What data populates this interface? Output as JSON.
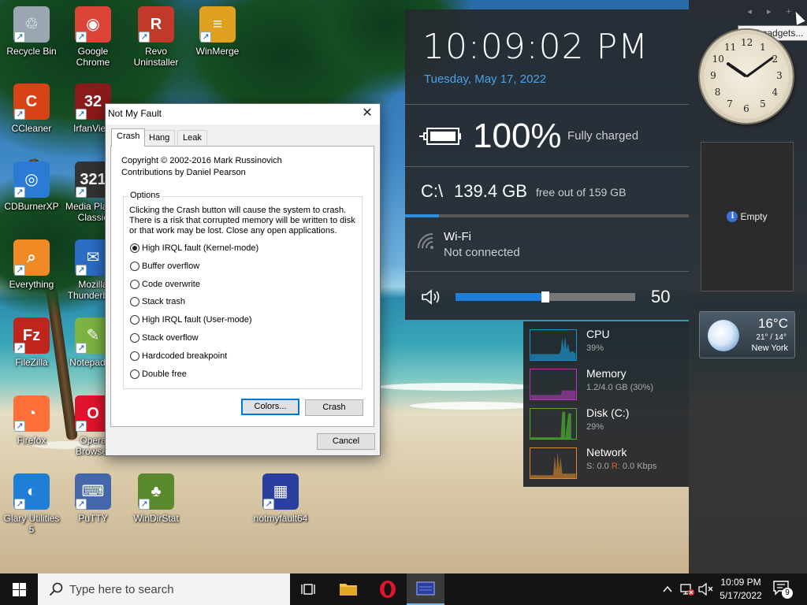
{
  "desktop": {
    "icons": [
      {
        "label": "Recycle Bin",
        "glyph": "♲",
        "color": "#9aa7b3"
      },
      {
        "label": "Google Chrome",
        "glyph": "◉",
        "color": "#db4437"
      },
      {
        "label": "Revo Uninstaller",
        "glyph": "R",
        "color": "#c0392b"
      },
      {
        "label": "WinMerge",
        "glyph": "≡",
        "color": "#e0a020"
      },
      {
        "label": "CCleaner",
        "glyph": "C",
        "color": "#d84315"
      },
      {
        "label": "IrfanView",
        "glyph": "32",
        "color": "#8b1a1a"
      },
      {
        "label": "CDBurnerXP",
        "glyph": "◎",
        "color": "#2a7bd6"
      },
      {
        "label": "Media Player Classic",
        "glyph": "321",
        "color": "#333333"
      },
      {
        "label": "Everything",
        "glyph": "⌕",
        "color": "#f08a24"
      },
      {
        "label": "Mozilla Thunderbird",
        "glyph": "✉",
        "color": "#2b6cc4"
      },
      {
        "label": "FileZilla",
        "glyph": "Fz",
        "color": "#c0251d"
      },
      {
        "label": "Notepad++",
        "glyph": "✎",
        "color": "#7cb342"
      },
      {
        "label": "Firefox",
        "glyph": "◔",
        "color": "#ff7139"
      },
      {
        "label": "Opera Browser",
        "glyph": "O",
        "color": "#e0142c"
      },
      {
        "label": "Glary Utilities 5",
        "glyph": "◐",
        "color": "#1f7fd6"
      },
      {
        "label": "PuTTY",
        "glyph": "⌨",
        "color": "#4466aa"
      },
      {
        "label": "WinDirStat",
        "glyph": "♣",
        "color": "#5b8a2d"
      },
      {
        "label": "notmyfault64",
        "glyph": "▦",
        "color": "#2b3f9e"
      }
    ]
  },
  "gadgets": {
    "tooltip": "Add gadgets...",
    "nav": "◂ ▸ +",
    "clock_numerals": [
      "12",
      "1",
      "2",
      "3",
      "4",
      "5",
      "6",
      "7",
      "8",
      "9",
      "10",
      "11"
    ],
    "clock_time": {
      "hour": 10,
      "minute": 9
    },
    "slideshow": {
      "info": "i",
      "label": "Empty"
    },
    "weather": {
      "temp": "16°C",
      "range": "21° / 14°",
      "city": "New York"
    }
  },
  "info_panel": {
    "time": "10:09:02 PM",
    "date": "Tuesday, May 17, 2022",
    "battery_percent": "100%",
    "battery_status": "Fully charged",
    "drive_label": "C:\\",
    "drive_free": "139.4 GB",
    "drive_total": "free out of 159 GB",
    "drive_used_fraction": 0.12,
    "wifi_name": "Wi-Fi",
    "wifi_status": "Not connected",
    "volume": 50,
    "volume_label": "50",
    "accent": "#2d8fe0"
  },
  "resources": [
    {
      "name": "CPU",
      "value": "39%",
      "color": "#1e90c8"
    },
    {
      "name": "Memory",
      "value": "1.2/4.0 GB (30%)",
      "color": "#b03ab8"
    },
    {
      "name": "Disk (C:)",
      "value": "29%",
      "color": "#4caf2e"
    },
    {
      "name": "Network",
      "value_s": "S: 0.0",
      "value_r_label": "R:",
      "value_r": "0.0 Kbps",
      "color": "#e08a2a"
    }
  ],
  "dialog": {
    "title": "Not My Fault",
    "close": "✕",
    "tabs": [
      "Crash",
      "Hang",
      "Leak"
    ],
    "copyright": "Copyright © 2002-2016 Mark Russinovich",
    "contributions": "Contributions by Daniel Pearson",
    "options_label": "Options",
    "options_desc": "Clicking the Crash button will cause the system to crash. There is a risk that corrupted memory will be written to disk or that work may be lost. Close any open applications.",
    "radios": [
      "High IRQL fault (Kernel-mode)",
      "Buffer overflow",
      "Code overwrite",
      "Stack trash",
      "High IRQL fault (User-mode)",
      "Stack overflow",
      "Hardcoded breakpoint",
      "Double free"
    ],
    "selected_radio": 0,
    "colors_button": "Colors...",
    "crash_button": "Crash",
    "cancel_button": "Cancel"
  },
  "taskbar": {
    "search_placeholder": "Type here to search",
    "tray_time": "10:09 PM",
    "tray_date": "5/17/2022",
    "notification_count": "9"
  }
}
